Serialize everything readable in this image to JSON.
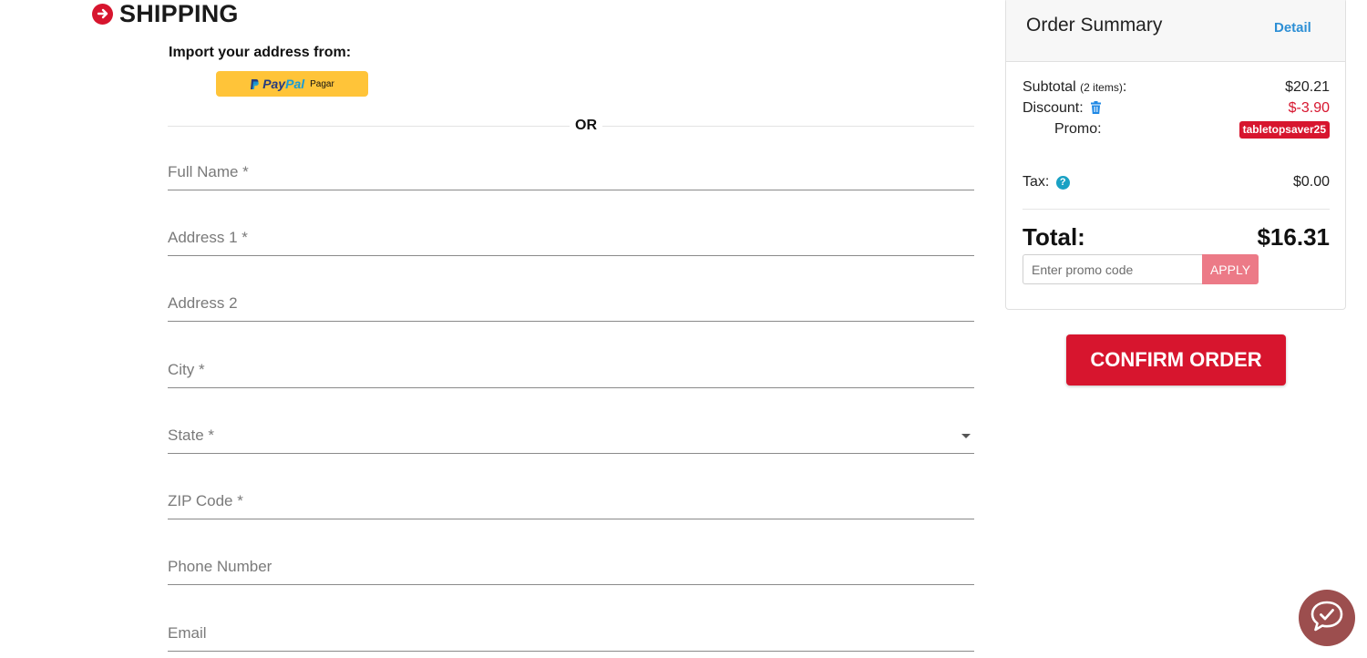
{
  "shipping": {
    "heading": "SHIPPING",
    "icon": "arrow-circle-right-icon",
    "import_label": "Import your address from:",
    "paypal": {
      "word_pay": "Pay",
      "word_pal": "Pal",
      "action": "Pagar"
    },
    "or_text": "OR",
    "fields": [
      {
        "label": "Full Name *"
      },
      {
        "label": "Address 1 *"
      },
      {
        "label": "Address 2"
      },
      {
        "label": "City *"
      },
      {
        "label": "State *"
      },
      {
        "label": "ZIP Code *"
      },
      {
        "label": "Phone Number"
      },
      {
        "label": "Email"
      }
    ]
  },
  "summary": {
    "title": "Order Summary",
    "detail_link": "Detail",
    "subtotal_label": "Subtotal",
    "subtotal_items": "(2 items)",
    "subtotal_colon": ":",
    "subtotal_value": "$20.21",
    "discount_label": "Discount:",
    "discount_value": "$-3.90",
    "promo_label": "Promo:",
    "promo_code": "tabletopsaver25",
    "tax_label": "Tax:",
    "tax_help": "?",
    "tax_value": "$0.00",
    "total_label": "Total:",
    "total_value": "$16.31",
    "promo_placeholder": "Enter promo code",
    "apply_label": "APPLY"
  },
  "confirm_label": "CONFIRM ORDER",
  "colors": {
    "brand_red": "#d7152e",
    "paypal_yellow": "#ffc439",
    "link_blue": "#2d8fd5",
    "chat_bg": "#9c4e4e"
  },
  "icons": {
    "trash": "trash-icon",
    "help": "help-circle-icon",
    "chat": "chat-check-icon",
    "caret": "caret-down-icon"
  }
}
